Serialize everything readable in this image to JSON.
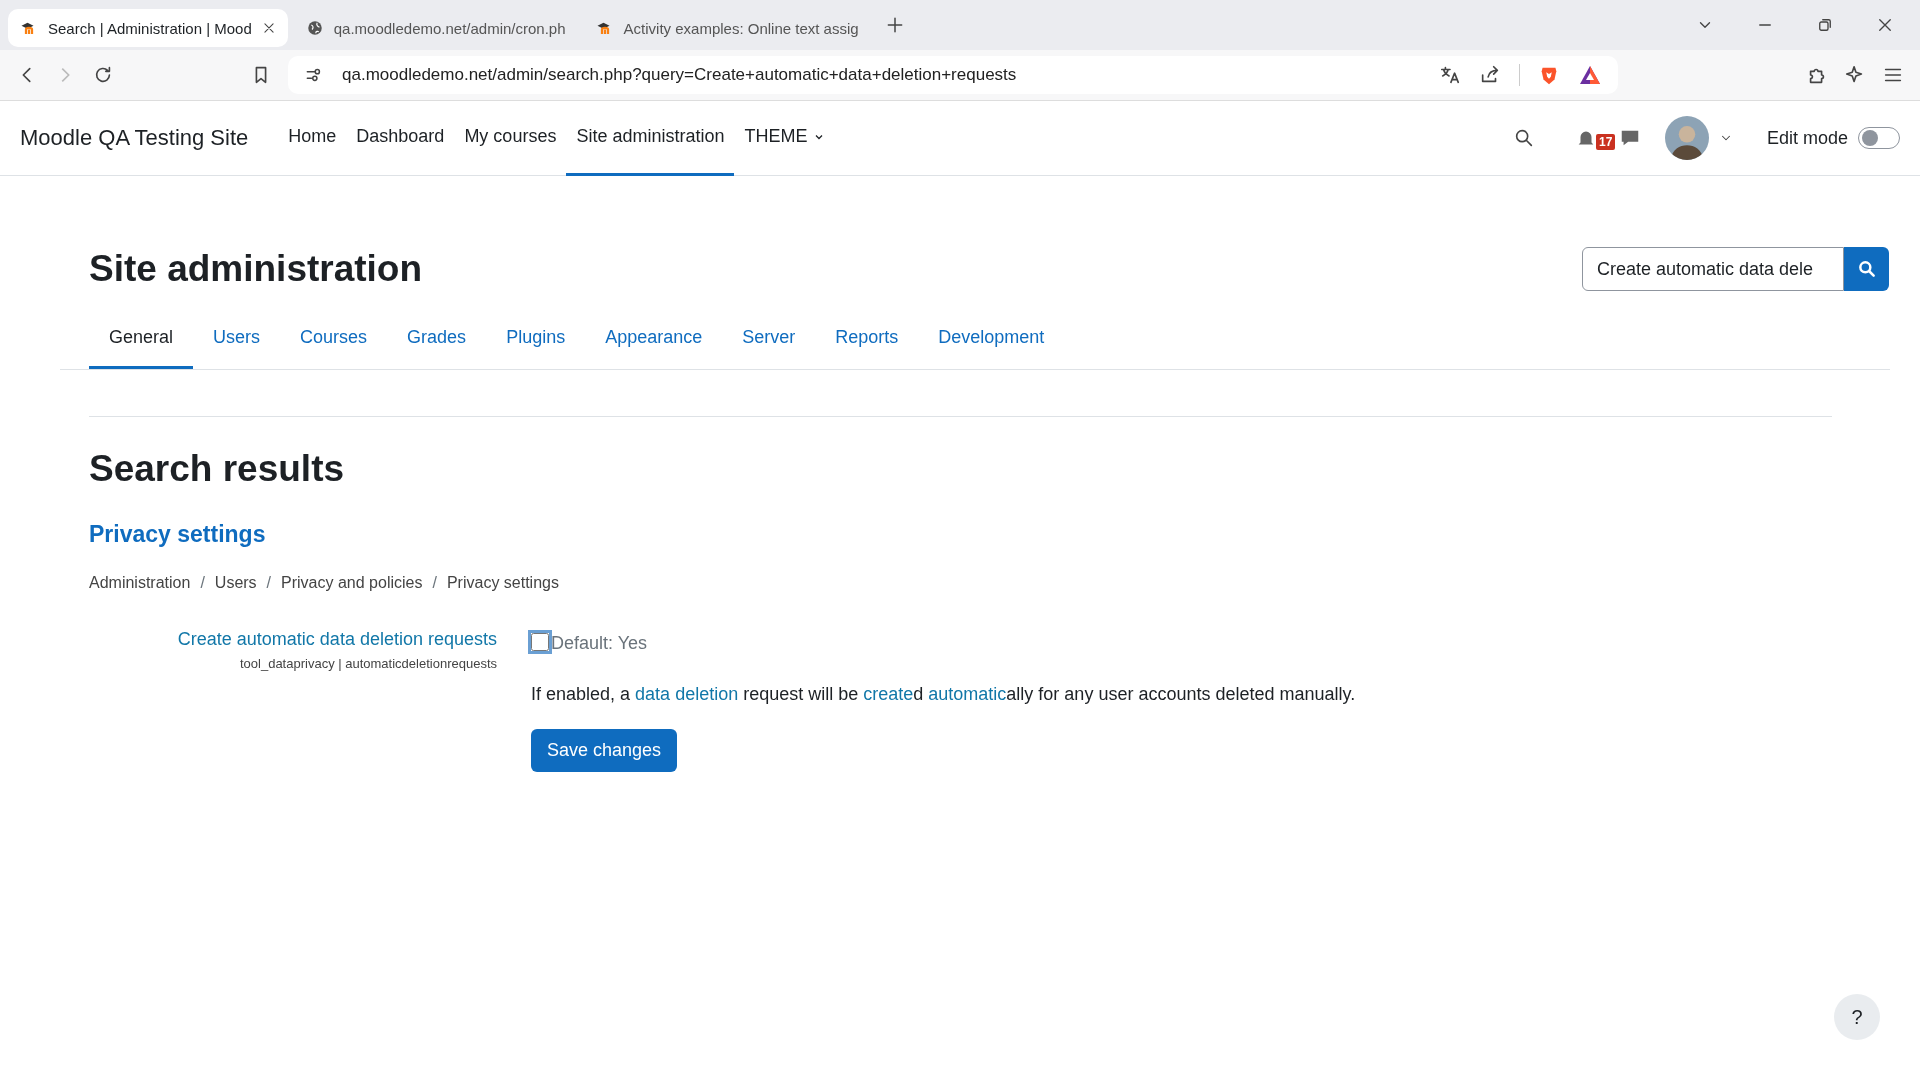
{
  "browser": {
    "tabs": [
      {
        "title": "Search | Administration | Mood",
        "selected": true
      },
      {
        "title": "qa.moodledemo.net/admin/cron.ph",
        "selected": false
      },
      {
        "title": "Activity examples: Online text assig",
        "selected": false
      }
    ],
    "url": "qa.moodledemo.net/admin/search.php?query=Create+automatic+data+deletion+requests"
  },
  "navbar": {
    "brand": "Moodle QA Testing Site",
    "items": [
      {
        "label": "Home",
        "selected": false
      },
      {
        "label": "Dashboard",
        "selected": false
      },
      {
        "label": "My courses",
        "selected": false
      },
      {
        "label": "Site administration",
        "selected": true
      },
      {
        "label": "THEME",
        "selected": false,
        "kind": "dropdown"
      }
    ],
    "notification_count": "17",
    "edit_mode": {
      "label": "Edit mode",
      "on": false
    }
  },
  "page": {
    "title": "Site administration",
    "search": {
      "value": "Create automatic data dele"
    },
    "tabs": [
      {
        "label": "General",
        "selected": true
      },
      {
        "label": "Users",
        "selected": false
      },
      {
        "label": "Courses",
        "selected": false
      },
      {
        "label": "Grades",
        "selected": false
      },
      {
        "label": "Plugins",
        "selected": false
      },
      {
        "label": "Appearance",
        "selected": false
      },
      {
        "label": "Server",
        "selected": false
      },
      {
        "label": "Reports",
        "selected": false
      },
      {
        "label": "Development",
        "selected": false
      }
    ],
    "results_heading": "Search results",
    "section": {
      "title": "Privacy settings",
      "breadcrumb": [
        {
          "kind": "link",
          "text": "Administration"
        },
        {
          "kind": "separator",
          "text": "/"
        },
        {
          "kind": "link",
          "text": "Users"
        },
        {
          "kind": "separator",
          "text": "/"
        },
        {
          "kind": "link",
          "text": "Privacy and policies"
        },
        {
          "kind": "separator",
          "text": "/"
        },
        {
          "kind": "link",
          "text": "Privacy settings"
        }
      ],
      "setting": {
        "label": "Create automatic data deletion requests",
        "id": "tool_dataprivacy | automaticdeletionrequests",
        "checked": false,
        "default": "Default: Yes",
        "description": [
          {
            "text": "If enabled, a ",
            "highlight": false
          },
          {
            "text": "data deletion",
            "highlight": true
          },
          {
            "text": " request will be ",
            "highlight": false
          },
          {
            "text": "create",
            "highlight": true
          },
          {
            "text": "d ",
            "highlight": false
          },
          {
            "text": "automatic",
            "highlight": true
          },
          {
            "text": "ally for any user accounts deleted manually.",
            "highlight": false
          }
        ]
      },
      "button": "Save changes"
    },
    "help": "?"
  }
}
